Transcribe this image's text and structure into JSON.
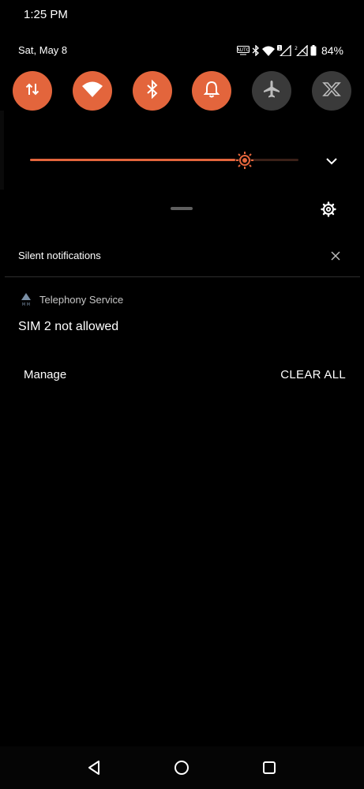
{
  "status": {
    "time": "1:25 PM",
    "date": "Sat, May 8",
    "battery": "84%",
    "icons": [
      "auto-brightness-icon",
      "bluetooth-icon",
      "wifi-icon",
      "signal-sim1-icon",
      "signal-sim2-icon",
      "battery-icon"
    ]
  },
  "quick_tiles": [
    {
      "name": "mobile-data",
      "icon": "data-arrows-icon",
      "state": "on"
    },
    {
      "name": "wifi",
      "icon": "wifi-icon",
      "state": "on"
    },
    {
      "name": "bluetooth",
      "icon": "bluetooth-icon",
      "state": "on"
    },
    {
      "name": "sound",
      "icon": "bell-icon",
      "state": "on"
    },
    {
      "name": "airplane",
      "icon": "airplane-icon",
      "state": "off"
    },
    {
      "name": "x-mode",
      "icon": "x-mode-icon",
      "state": "off"
    }
  ],
  "brightness": {
    "level": 0.8,
    "icon": "brightness-sun-icon"
  },
  "colors": {
    "accent": "#e3653c",
    "tile_off": "#3a3a3a",
    "background": "#000000"
  },
  "notifications": {
    "section_title": "Silent notifications",
    "items": [
      {
        "app_name": "Telephony Service",
        "title": "SIM 2 not allowed"
      }
    ],
    "manage_label": "Manage",
    "clear_all_label": "CLEAR ALL"
  },
  "navbar": {
    "buttons": [
      "back-icon",
      "home-icon",
      "recents-icon"
    ]
  }
}
